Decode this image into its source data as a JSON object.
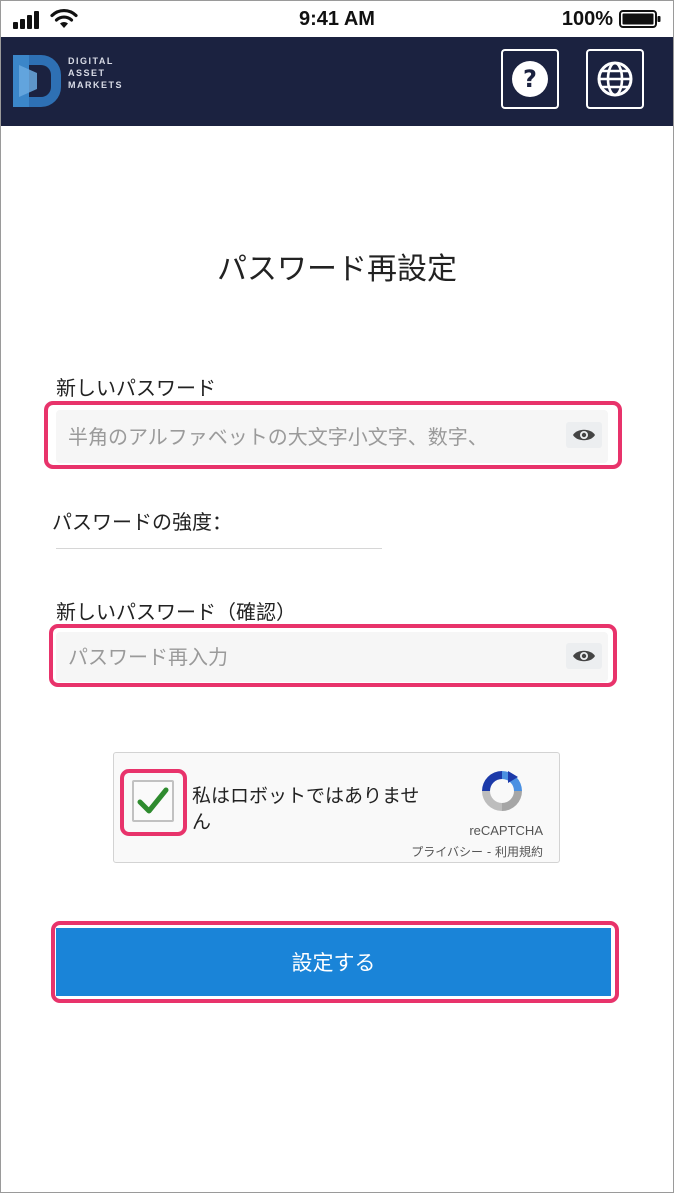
{
  "status_bar": {
    "time": "9:41 AM",
    "battery_percent": "100%",
    "signal_icon": "cellular-signal-icon",
    "wifi_icon": "wifi-icon",
    "battery_icon": "battery-full-icon"
  },
  "header": {
    "logo_icon": "digital-asset-markets-logo",
    "logo_words": [
      "DIGITAL",
      "ASSET",
      "MARKETS"
    ],
    "help_icon": "question-circle-icon",
    "language_icon": "globe-icon",
    "background_color": "#1b2240"
  },
  "page": {
    "title": "パスワード再設定"
  },
  "new_password": {
    "label": "新しいパスワード",
    "placeholder": "半角のアルファベットの大文字小文字、数字、",
    "value": "",
    "toggle_icon": "eye-icon"
  },
  "strength": {
    "label": "パスワードの強度："
  },
  "confirm_password": {
    "label": "新しいパスワード（確認）",
    "placeholder": "パスワード再入力",
    "value": "",
    "toggle_icon": "eye-icon"
  },
  "recaptcha": {
    "checkbox_label": "私はロボットではありません",
    "checked": true,
    "brand": "reCAPTCHA",
    "links": "プライバシー - 利用規約",
    "checkmark_icon": "green-checkmark-icon",
    "logo_icon": "recaptcha-logo-icon"
  },
  "submit": {
    "label": "設定する",
    "color": "#1a84d8"
  },
  "highlight_color": "#e8336b"
}
